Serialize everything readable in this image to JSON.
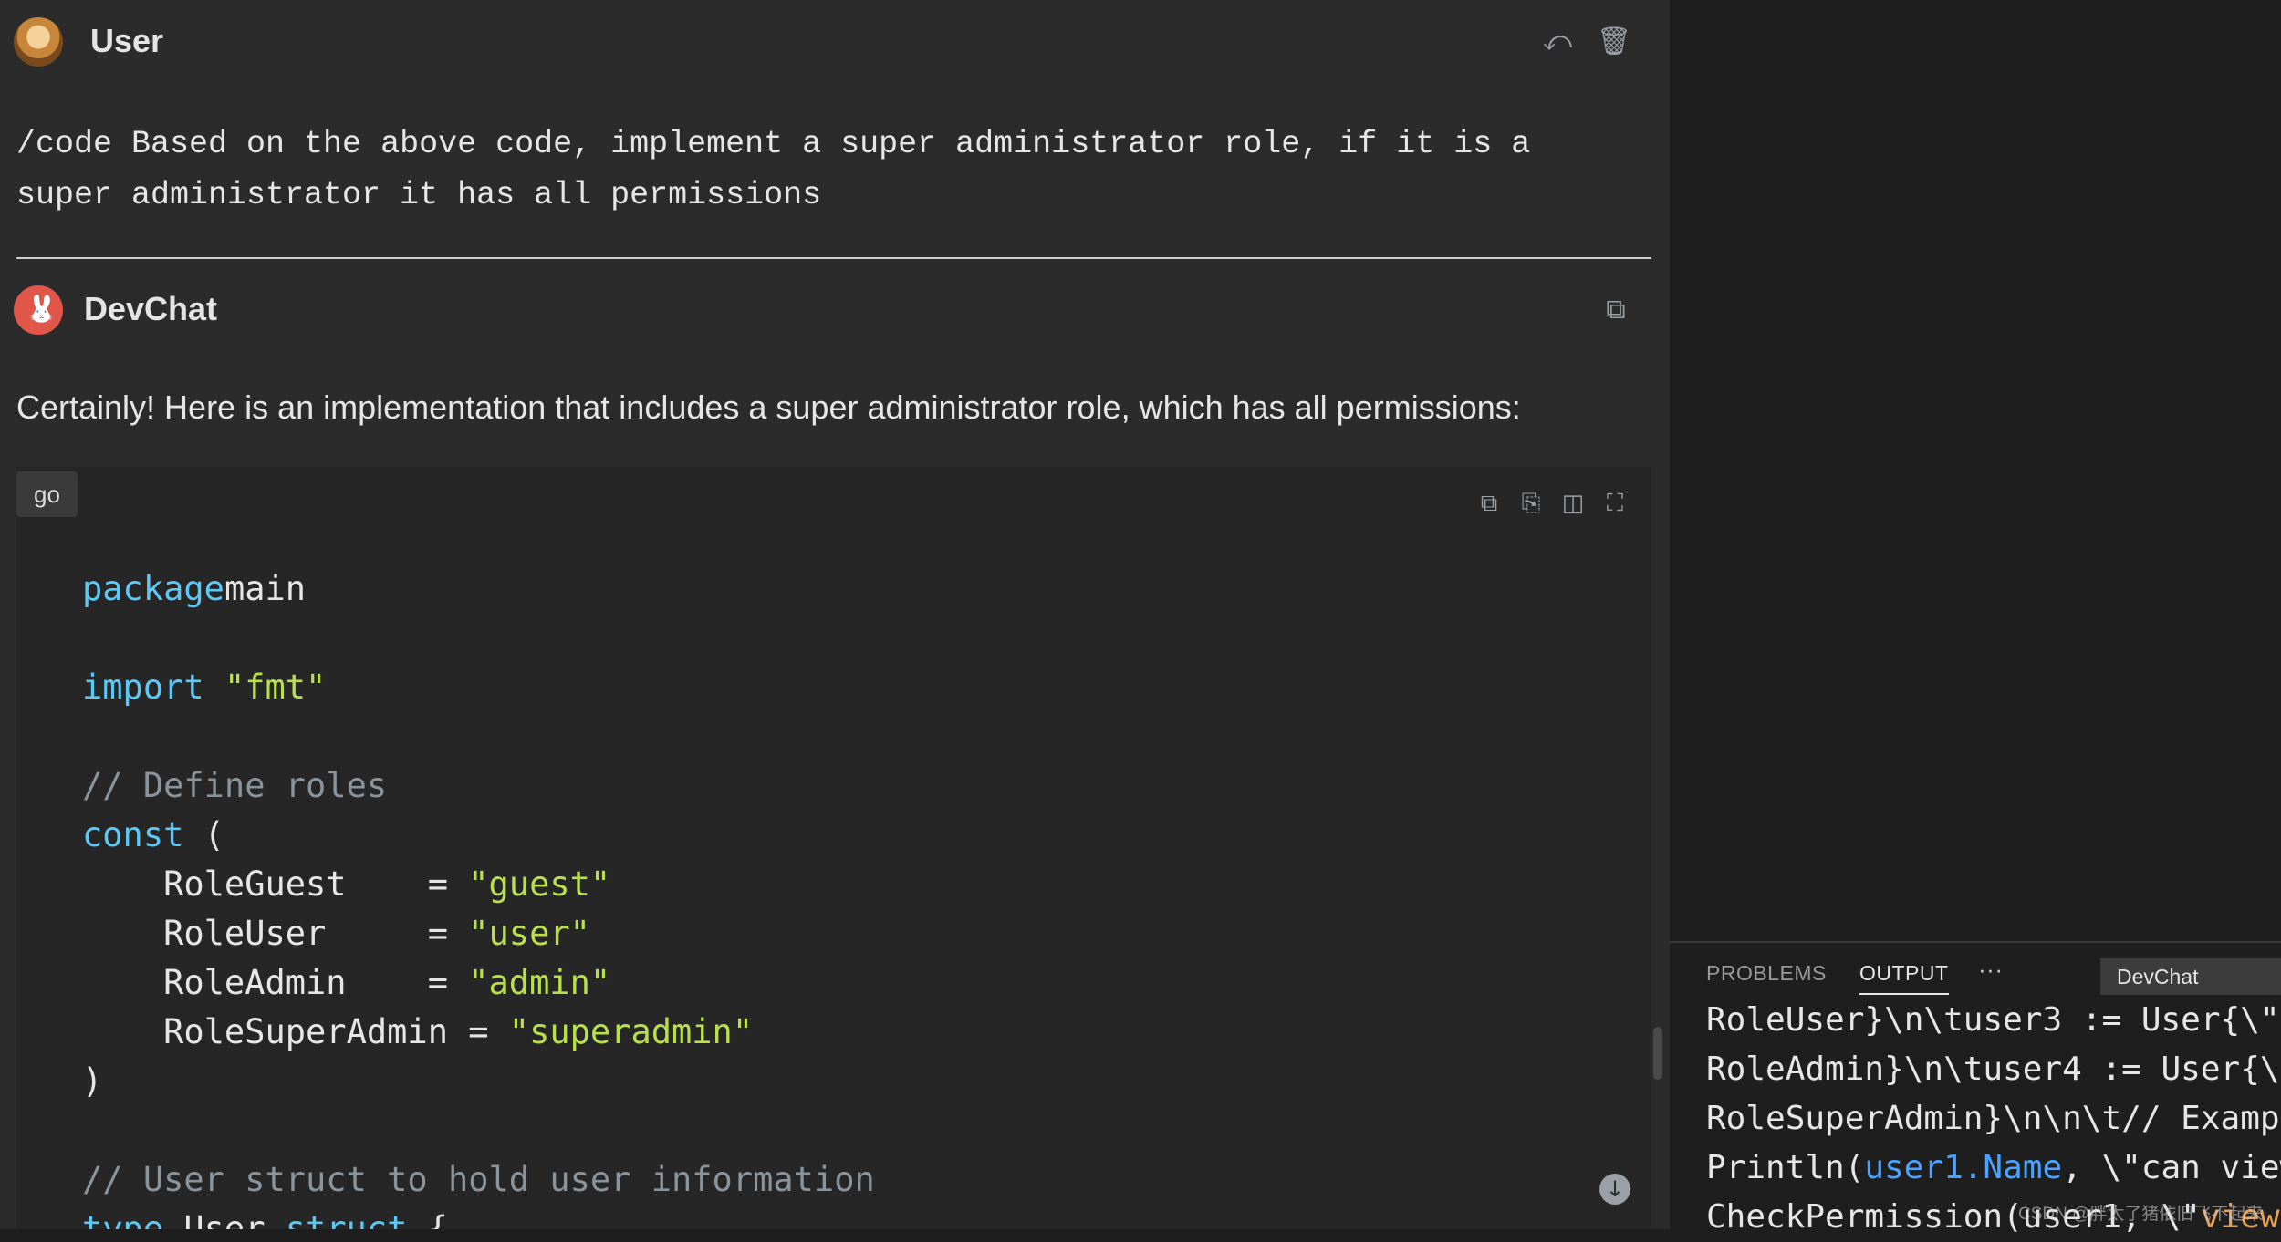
{
  "user_message": {
    "author": "User",
    "text": "/code Based on the above code, implement a super administrator role, if it is a super administrator it has all permissions"
  },
  "assistant_message": {
    "author": "DevChat",
    "text": "Certainly! Here is an implementation that includes a super administrator role, which has all permissions:",
    "code_language": "go"
  },
  "code": [
    [
      [
        "kw",
        "package"
      ],
      [
        "",
        "main"
      ]
    ],
    [],
    [
      [
        "kw",
        "import"
      ],
      [
        "",
        " "
      ],
      [
        "str",
        "\"fmt\""
      ]
    ],
    [],
    [
      [
        "cm",
        "// Define roles"
      ]
    ],
    [
      [
        "kw",
        "const"
      ],
      [
        "",
        " ("
      ]
    ],
    [
      [
        "",
        "    RoleGuest    = "
      ],
      [
        "str",
        "\"guest\""
      ]
    ],
    [
      [
        "",
        "    RoleUser     = "
      ],
      [
        "str",
        "\"user\""
      ]
    ],
    [
      [
        "",
        "    RoleAdmin    = "
      ],
      [
        "str",
        "\"admin\""
      ]
    ],
    [
      [
        "",
        "    RoleSuperAdmin = "
      ],
      [
        "str",
        "\"superadmin\""
      ]
    ],
    [
      [
        "",
        ")"
      ]
    ],
    [],
    [
      [
        "cm",
        "// User struct to hold user information"
      ]
    ],
    [
      [
        "kw",
        "type"
      ],
      [
        "",
        " User "
      ],
      [
        "kw",
        "struct"
      ],
      [
        "",
        " {"
      ]
    ]
  ],
  "panel": {
    "tabs": [
      "PROBLEMS",
      "OUTPUT"
    ],
    "active_tab": "OUTPUT",
    "more": "···",
    "channel": "DevChat",
    "output_lines": [
      [
        [
          "",
          "RoleUser}\\n\\tuser3 := User{\\\""
        ]
      ],
      [
        [
          "",
          "RoleAdmin}\\n\\tuser4 := User{\\\""
        ]
      ],
      [
        [
          "",
          "RoleSuperAdmin}\\n\\n\\t// Example"
        ]
      ],
      [
        [
          "",
          "Println("
        ],
        [
          "oblue",
          "user1.Name"
        ],
        [
          "",
          ", \\\"can view"
        ]
      ],
      [
        [
          "",
          "CheckPermission(user1, \\\""
        ],
        [
          "oorange",
          "view"
        ]
      ]
    ]
  },
  "watermark": "CSDN @胖太了猪依旧飞不起来",
  "icons": {
    "regenerate": "regenerate-icon",
    "delete": "trash-icon",
    "copy": "copy-icon"
  }
}
